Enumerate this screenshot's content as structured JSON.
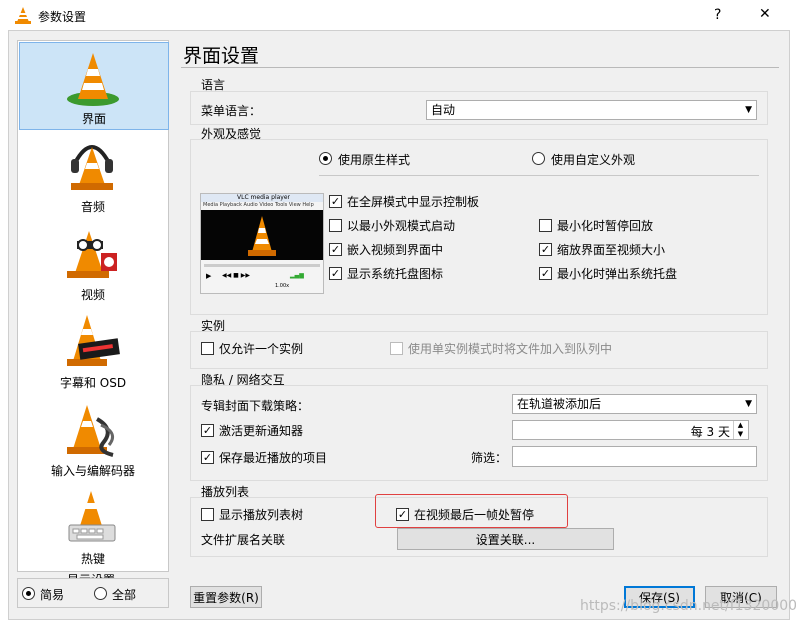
{
  "window": {
    "title": "参数设置",
    "help_glyph": "?",
    "close_glyph": "✕"
  },
  "sidebar": {
    "items": [
      {
        "label": "界面",
        "selected": true
      },
      {
        "label": "音频"
      },
      {
        "label": "视频"
      },
      {
        "label": "字幕和 OSD"
      },
      {
        "label": "输入与编解码器"
      },
      {
        "label": "热键"
      }
    ],
    "show_settings_label": "显示设置",
    "mode_simple": "简易",
    "mode_all": "全部"
  },
  "page": {
    "title": "界面设置"
  },
  "language": {
    "group_title": "语言",
    "menu_language_label": "菜单语言：",
    "menu_language_value": "自动"
  },
  "appearance": {
    "group_title": "外观及感觉",
    "native_style": "使用原生样式",
    "custom_skin": "使用自定义外观",
    "preview_title": "VLC media player",
    "preview_menu": [
      "Media",
      "Playback",
      "Audio",
      "Video",
      "Tools",
      "View",
      "Help"
    ],
    "preview_time": "1.00x",
    "options": [
      {
        "label": "在全屏模式中显示控制板",
        "checked": true
      },
      {
        "label": "以最小外观模式启动",
        "checked": false
      },
      {
        "label": "最小化时暂停回放",
        "checked": false
      },
      {
        "label": "嵌入视频到界面中",
        "checked": true
      },
      {
        "label": "缩放界面至视频大小",
        "checked": true
      },
      {
        "label": "显示系统托盘图标",
        "checked": true
      },
      {
        "label": "最小化时弹出系统托盘",
        "checked": true
      }
    ]
  },
  "instance": {
    "group_title": "实例",
    "one_instance": "仅允许一个实例",
    "enqueue": "使用单实例模式时将文件加入到队列中"
  },
  "privacy": {
    "group_title": "隐私 / 网络交互",
    "album_art_label": "专辑封面下载策略：",
    "album_art_value": "在轨道被添加后",
    "update_notifier": "激活更新通知器",
    "update_value": "每 3 天",
    "save_recent": "保存最近播放的项目",
    "filter_label": "筛选：",
    "filter_value": ""
  },
  "playlist": {
    "group_title": "播放列表",
    "show_tree": "显示播放列表树",
    "pause_last_frame": "在视频最后一帧处暂停",
    "file_ext_label": "文件扩展名关联",
    "set_assoc_button": "设置关联..."
  },
  "footer": {
    "reset": "重置参数(R)",
    "save": "保存(S)",
    "cancel": "取消(C)",
    "watermark": "https://blog.csdn.net/f1320000"
  },
  "colors": {
    "accent": "#0078d7",
    "highlight": "#e04040",
    "cone_orange": "#f08a00"
  }
}
